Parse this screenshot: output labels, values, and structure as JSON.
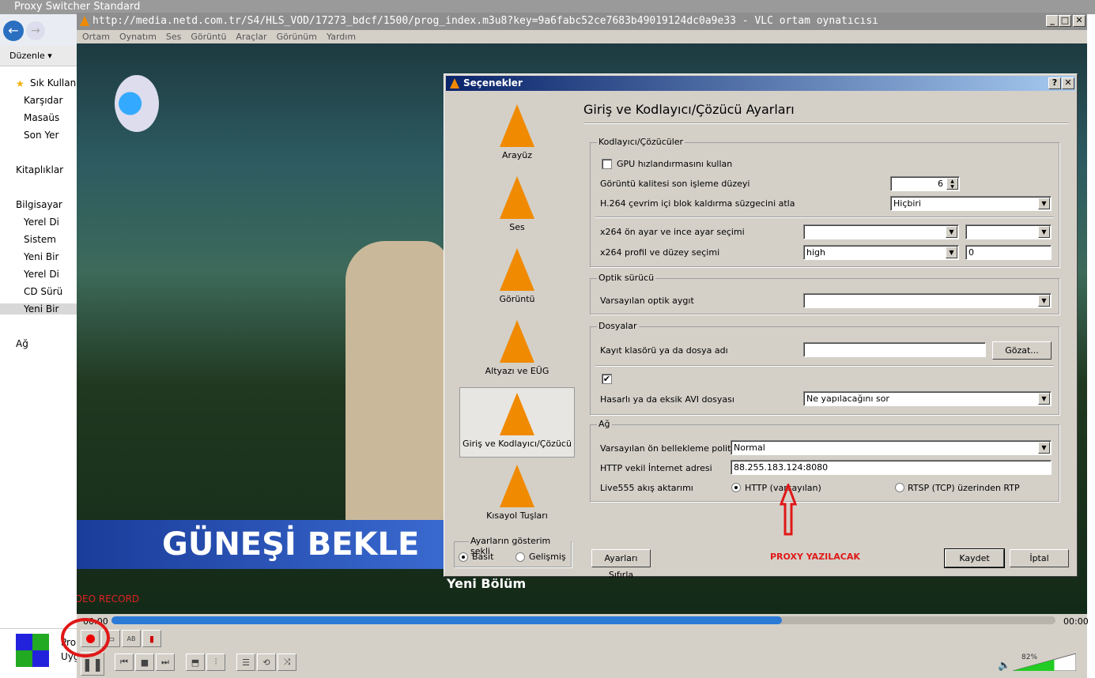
{
  "explorer": {
    "title": "Proxy Switcher Standard",
    "toolbar_organize": "Düzenle",
    "nav": [
      "Sık Kullan",
      "Karşıdar",
      "Masaüs",
      "Son Yer",
      "Kitaplıklar",
      "Bilgisayar",
      "Yerel Di",
      "Sistem",
      "Yeni Bir",
      "Yerel Di",
      "CD Sürü",
      "Yeni Bir",
      "Ağ"
    ],
    "app_line1": "Pro",
    "app_line2": "Uyg"
  },
  "vlc": {
    "title": "http://media.netd.com.tr/S4/HLS_VOD/17273_bdcf/1500/prog_index.m3u8?key=9a6fabc52ce7683b49019124dc0a9e33 - VLC ortam oynatıcısı",
    "menu": [
      "Ortam",
      "Oynatım",
      "Ses",
      "Görüntü",
      "Araçlar",
      "Görünüm",
      "Yardım"
    ],
    "video_banner": "GÜNEŞİ BEKLE",
    "video_subtitle": "Yeni Bölüm",
    "time_elapsed": "00:00",
    "time_total": "00:00",
    "progress_percent": 71,
    "volume_label": "82%",
    "volume_percent": 82,
    "annotation": "VİDEO RECORD"
  },
  "dialog": {
    "title": "Seçenekler",
    "help": "?",
    "close": "✕",
    "categories": [
      {
        "label": "Arayüz"
      },
      {
        "label": "Ses"
      },
      {
        "label": "Görüntü"
      },
      {
        "label": "Altyazı ve EÜG"
      },
      {
        "label": "Giriş ve Kodlayıcı/Çözücü",
        "selected": true
      },
      {
        "label": "Kısayol Tuşları"
      }
    ],
    "view_mode": {
      "legend": "Ayarların gösterim şekli",
      "basic": "Basit",
      "advanced": "Gelişmiş",
      "selected": "Basit"
    },
    "heading": "Giriş ve Kodlayıcı/Çözücü Ayarları",
    "codecs": {
      "legend": "Kodlayıcı/Çözücüler",
      "gpu_label": "GPU hızlandırmasını kullan",
      "gpu_checked": false,
      "pp_label": "Görüntü kalitesi son işleme düzeyi",
      "pp_value": "6",
      "h264_label": "H.264 çevrim içi blok kaldırma süzgecini atla",
      "h264_value": "Hiçbiri",
      "x264_preset_label": "x264 ön ayar ve ince ayar seçimi",
      "x264_preset_value": "",
      "x264_tune_value": "",
      "x264_profile_label": "x264 profil ve düzey seçimi",
      "x264_profile_value": "high",
      "x264_level_value": "0"
    },
    "optical": {
      "legend": "Optik sürücü",
      "device_label": "Varsayılan optik aygıt",
      "device_value": ""
    },
    "files": {
      "legend": "Dosyalar",
      "record_label": "Kayıt klasörü ya da dosya adı",
      "record_value": "",
      "browse": "Gözat...",
      "checkbox_checked": true,
      "avi_label": "Hasarlı ya da eksik AVI dosyası",
      "avi_value": "Ne yapılacağını sor"
    },
    "network": {
      "legend": "Ağ",
      "cache_label": "Varsayılan ön bellekleme politikası",
      "cache_value": "Normal",
      "proxy_label": "HTTP vekil İnternet adresi",
      "proxy_value": "88.255.183.124:8080",
      "live555_label": "Live555 akış aktarımı",
      "http_option": "HTTP (varsayılan)",
      "rtsp_option": "RTSP (TCP) üzerinden RTP",
      "selected": "HTTP (varsayılan)"
    },
    "reset": "Ayarları Sıfırla",
    "save": "Kaydet",
    "cancel": "İptal",
    "annotation": "PROXY YAZILACAK"
  }
}
